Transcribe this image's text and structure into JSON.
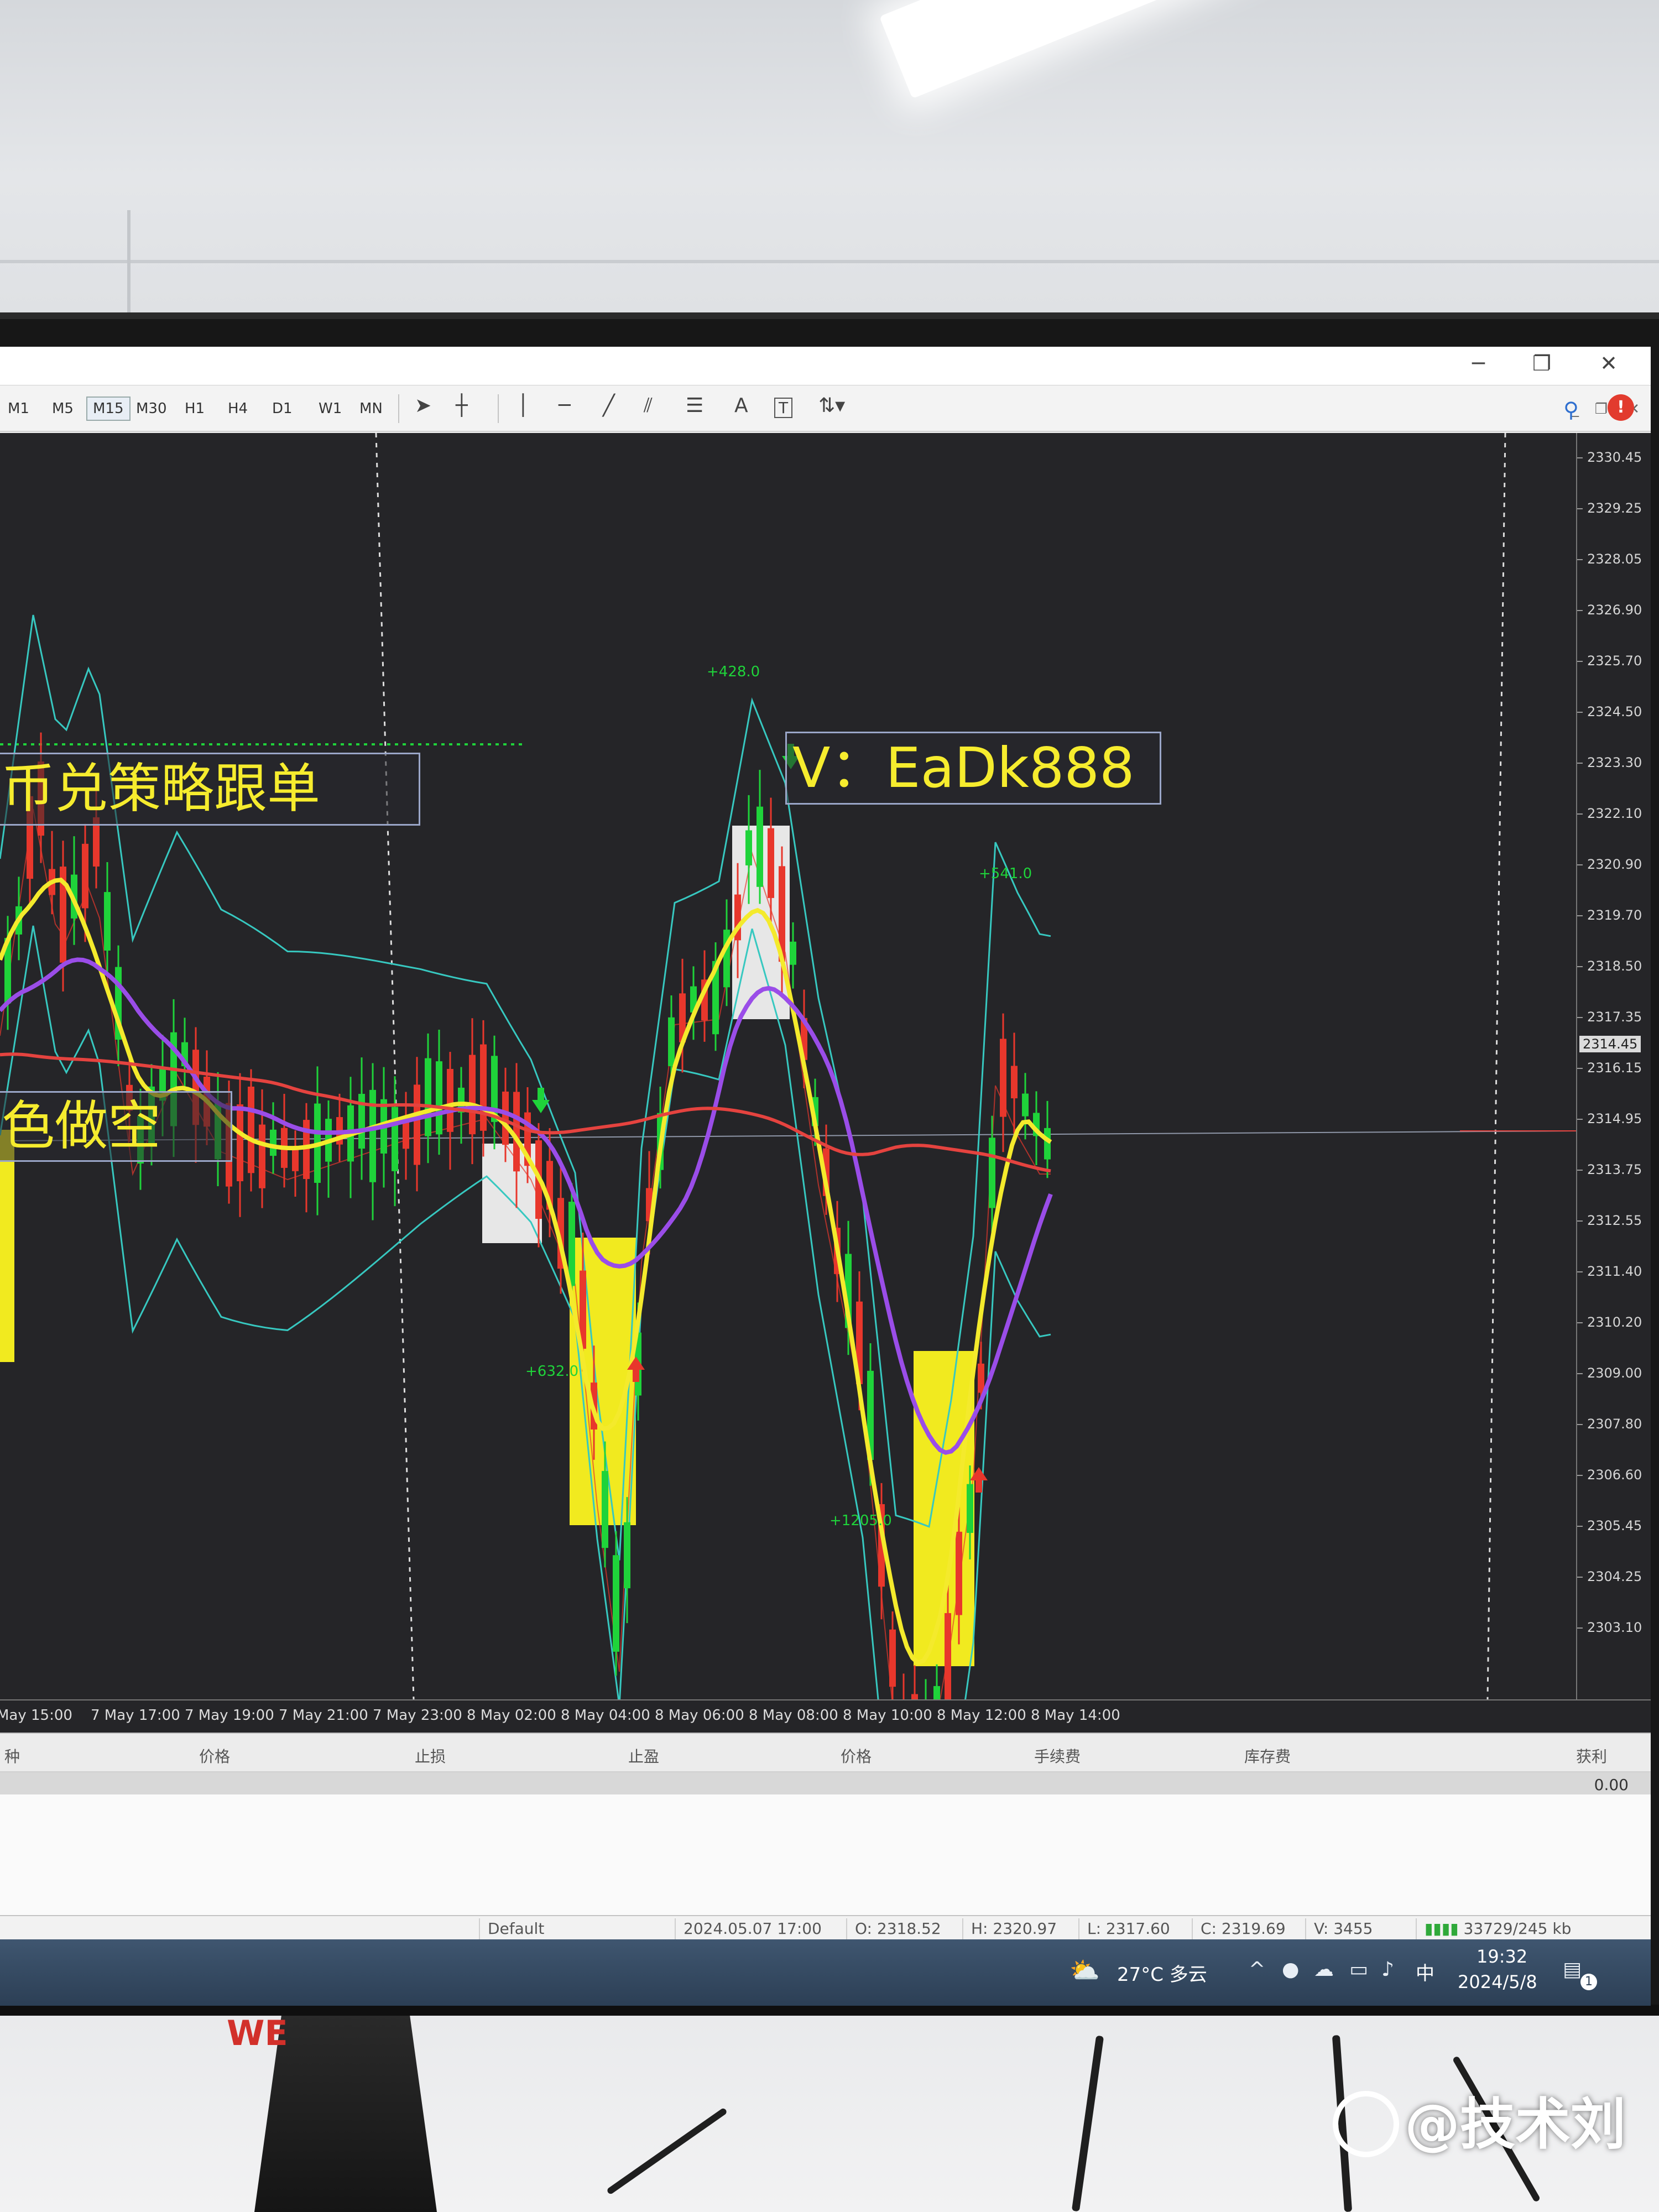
{
  "window": {
    "timeframes": [
      "M1",
      "M5",
      "M15",
      "M30",
      "H1",
      "H4",
      "D1",
      "W1",
      "MN"
    ],
    "active_timeframe": "M15",
    "toolbar_glyphs": {
      "text_tool": "A",
      "text_label_tool": "T"
    }
  },
  "chart": {
    "price_levels": [
      "2330.45",
      "2329.25",
      "2328.05",
      "2326.90",
      "2325.70",
      "2324.50",
      "2323.30",
      "2322.10",
      "2320.90",
      "2319.70",
      "2318.50",
      "2317.35",
      "2316.15",
      "2314.95",
      "2313.75",
      "2312.55",
      "2311.40",
      "2310.20",
      "2309.00",
      "2307.80",
      "2306.60",
      "2305.45",
      "2304.25",
      "2303.10"
    ],
    "current_price": "2314.45",
    "time_labels": [
      "May 15:00",
      "7 May 17:00",
      "7 May 19:00",
      "7 May 21:00",
      "7 May 23:00",
      "8 May 02:00",
      "8 May 04:00",
      "8 May 06:00",
      "8 May 08:00",
      "8 May 10:00",
      "8 May 12:00",
      "8 May 14:00"
    ],
    "annotations": [
      "+428.0",
      "+632.0",
      "+1205.0",
      "+541.0"
    ],
    "overlay_texts": {
      "strategy_banner": "币兑策略跟单",
      "contact_banner": "V：EaDk888",
      "short_hint": "色做空"
    },
    "colors": {
      "background": "#252528",
      "bull": "#1fd33a",
      "bear": "#e8372c",
      "ma_yellow": "#f4ea2c",
      "ma_purple": "#9a4de8",
      "ma_red": "#e5433f",
      "band": "#37c8c0",
      "highlight": "#f1ea1f"
    }
  },
  "terminal": {
    "columns": [
      "种",
      "价格",
      "止损",
      "止盈",
      "价格",
      "手续费",
      "库存费",
      "获利"
    ],
    "profit_total": "0.00"
  },
  "statusbar": {
    "profile": "Default",
    "datetime": "2024.05.07 17:00",
    "open": "O: 2318.52",
    "high": "H: 2320.97",
    "low": "L: 2317.60",
    "close": "C: 2319.69",
    "volume": "V: 3455",
    "traffic": "33729/245 kb"
  },
  "taskbar": {
    "weather": "27°C  多云",
    "ime": "中",
    "clock_time": "19:32",
    "clock_date": "2024/5/8",
    "notification_badge": "1"
  },
  "watermark": "@技术刘"
}
